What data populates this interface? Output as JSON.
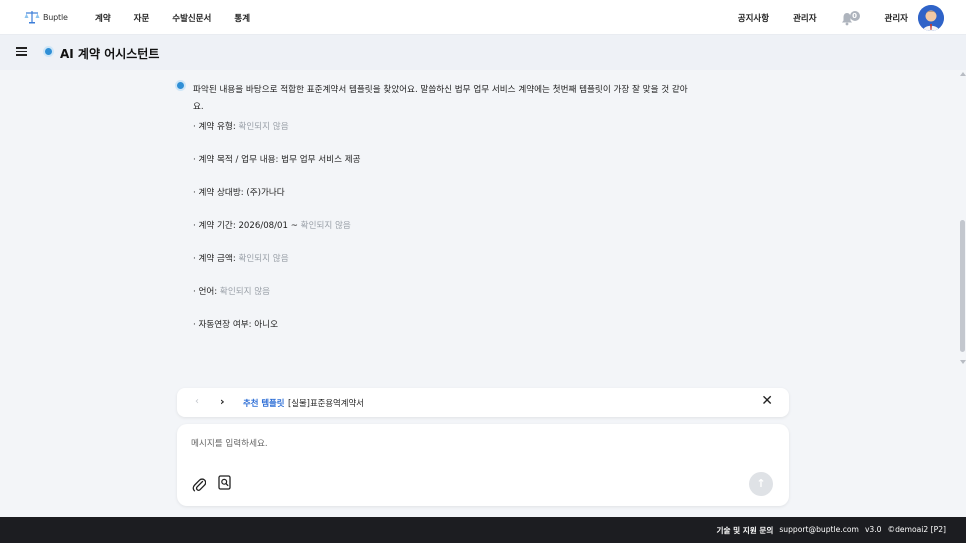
{
  "brand": {
    "name": "Buptle"
  },
  "nav": {
    "menu": [
      "계약",
      "자문",
      "수발신문서",
      "통계"
    ],
    "notice": "공지사항",
    "admin_link": "관리자",
    "notification_count": "0",
    "user_name": "관리자"
  },
  "subheader": {
    "title": "AI 계약 어시스턴트"
  },
  "message": {
    "text": "파악된 내용을 바탕으로 적합한 표준계약서 템플릿을 찾았어요. 말씀하신 법무 업무 서비스 계약에는 첫번째 템플릿이 가장 잘 맞을 것 같아요.",
    "items": [
      {
        "label": "· 계약 유형: ",
        "value": "확인되지 않음",
        "muted": true
      },
      {
        "label": "· 계약 목적 / 업무 내용: 법무 업무 서비스 제공",
        "value": "",
        "muted": false
      },
      {
        "label": "· 계약 상대방: (주)가나다",
        "value": "",
        "muted": false
      },
      {
        "label": "· 계약 기간: 2026/08/01 ~ ",
        "value": "확인되지 않음",
        "muted": true
      },
      {
        "label": "· 계약 금액: ",
        "value": "확인되지 않음",
        "muted": true
      },
      {
        "label": "· 언어: ",
        "value": "확인되지 않음",
        "muted": true
      },
      {
        "label": "· 자동연장 여부: 아니오",
        "value": "",
        "muted": false
      }
    ]
  },
  "template_bar": {
    "prev": "‹",
    "next": "›",
    "tag": "추천 템플릿",
    "name": "[실물]표준용역계약서",
    "close": "✕"
  },
  "input": {
    "placeholder": "메시지를 입력하세요.",
    "value": ""
  },
  "icons": {
    "attach": "paperclip-icon",
    "doc_search": "document-search-icon",
    "send": "arrow-up-icon",
    "bell": "bell-icon",
    "menu": "hamburger-icon"
  },
  "footer": {
    "label": "기술 및 지원 문의",
    "email": "support@buptle.com",
    "version": "v3.0",
    "copyright": "©demoai2 [P2]"
  },
  "colors": {
    "accent": "#2f6fd6",
    "footer_bg": "#1c1d21",
    "muted_text": "#9aa0a8"
  }
}
